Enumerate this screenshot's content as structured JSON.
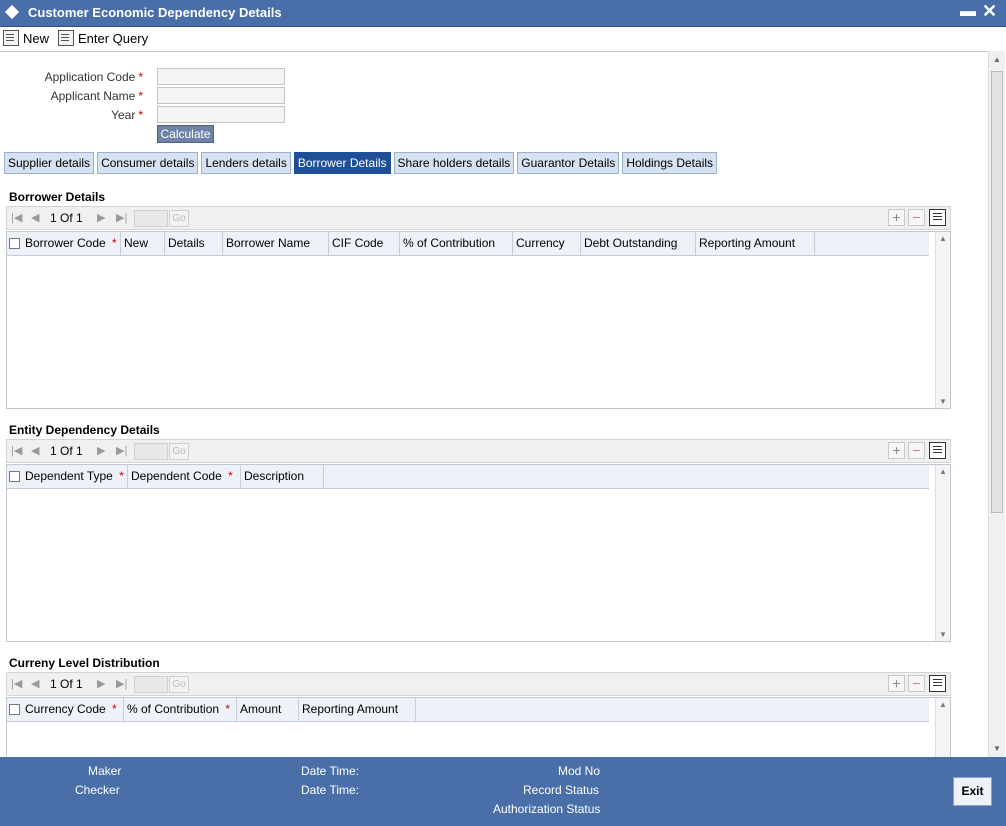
{
  "window": {
    "title": "Customer Economic Dependency Details",
    "minimize_glyph": "▬",
    "close_glyph": "✕"
  },
  "toolbar": {
    "new_label": "New",
    "enter_query_label": "Enter Query"
  },
  "form": {
    "application_code_label": "Application Code",
    "applicant_name_label": "Applicant Name",
    "year_label": "Year",
    "required_mark": "*",
    "calculate_label": "Calculate"
  },
  "tabs": [
    {
      "label": "Supplier details"
    },
    {
      "label": "Consumer details"
    },
    {
      "label": "Lenders details"
    },
    {
      "label": "Borrower Details",
      "active": true
    },
    {
      "label": "Share holders details"
    },
    {
      "label": "Guarantor Details"
    },
    {
      "label": "Holdings Details"
    }
  ],
  "pager": {
    "text": "1 Of 1",
    "go_label": "Go"
  },
  "borrower": {
    "title": "Borrower Details",
    "columns": [
      "Borrower Code *",
      "New",
      "Details",
      "Borrower Name",
      "CIF Code",
      "% of Contribution",
      "Currency",
      "Debt Outstanding",
      "Reporting Amount"
    ]
  },
  "entity": {
    "title": "Entity Dependency Details",
    "columns": [
      "Dependent Type *",
      "Dependent Code *",
      "Description"
    ]
  },
  "currency": {
    "title": "Curreny Level Distribution",
    "columns": [
      "Currency Code *",
      "% of Contribution *",
      "Amount",
      "Reporting Amount"
    ]
  },
  "footer": {
    "maker_label": "Maker",
    "checker_label": "Checker",
    "date_time_label": "Date Time:",
    "mod_no_label": "Mod No",
    "record_status_label": "Record Status",
    "authorization_status_label": "Authorization Status",
    "exit_label": "Exit"
  },
  "colors": {
    "titlebar": "#4a6ea8",
    "active_tab": "#1f4f97",
    "tab": "#d6e2f1",
    "required": "#cc0000"
  }
}
